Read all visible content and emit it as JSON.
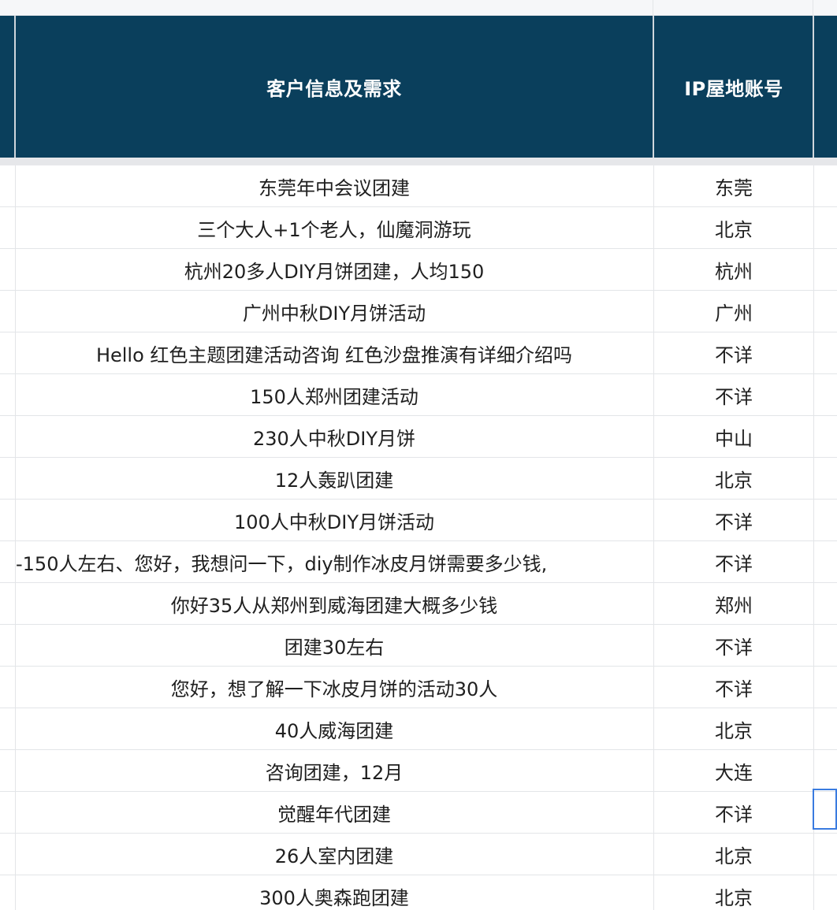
{
  "header": {
    "col_need": "客户信息及需求",
    "col_ip": "IP屋地账号"
  },
  "rows": [
    {
      "need": "东莞年中会议团建",
      "ip": "东莞"
    },
    {
      "need": "三个大人+1个老人，仙魔洞游玩",
      "ip": "北京"
    },
    {
      "need": "杭州20多人DIY月饼团建，人均150",
      "ip": "杭州"
    },
    {
      "need": "广州中秋DIY月饼活动",
      "ip": "广州"
    },
    {
      "need": "Hello 红色主题团建活动咨询 红色沙盘推演有详细介绍吗",
      "ip": "不详"
    },
    {
      "need": "150人郑州团建活动",
      "ip": "不详"
    },
    {
      "need": "230人中秋DIY月饼",
      "ip": "中山"
    },
    {
      "need": "12人轰趴团建",
      "ip": "北京"
    },
    {
      "need": "100人中秋DIY月饼活动",
      "ip": "不详"
    },
    {
      "need": "-150人左右、您好，我想问一下，diy制作冰皮月饼需要多少钱,",
      "ip": "不详"
    },
    {
      "need": "你好35人从郑州到威海团建大概多少钱",
      "ip": "郑州"
    },
    {
      "need": "团建30左右",
      "ip": "不详"
    },
    {
      "need": "您好，想了解一下冰皮月饼的活动30人",
      "ip": "不详"
    },
    {
      "need": "40人威海团建",
      "ip": "北京"
    },
    {
      "need": "咨询团建，12月",
      "ip": "大连"
    },
    {
      "need": "觉醒年代团建",
      "ip": "不详"
    },
    {
      "need": "26人室内团建",
      "ip": "北京"
    },
    {
      "need": "300人奥森跑团建",
      "ip": "北京"
    }
  ]
}
